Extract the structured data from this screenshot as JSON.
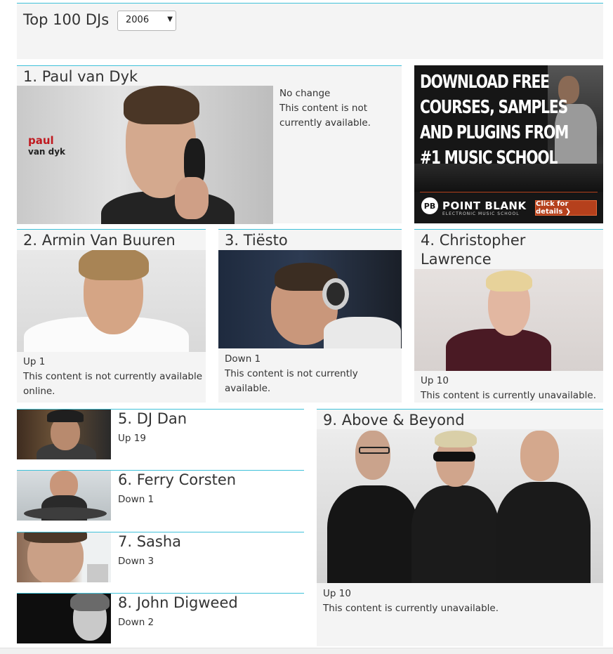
{
  "header": {
    "title": "Top 100 DJs",
    "year_select": "2006"
  },
  "djs": [
    {
      "title": "1. Paul van Dyk",
      "change": "No change",
      "note": "This content is not currently available.",
      "logo_line1": "paul",
      "logo_line2": "van dyk"
    },
    {
      "title": "2. Armin Van Buuren",
      "change": "Up 1",
      "note": "This content is not currently available online."
    },
    {
      "title": "3. Tiësto",
      "change": "Down 1",
      "note": "This content is not currently available."
    },
    {
      "title": "4. Christopher Lawrence",
      "change": "Up 10",
      "note": "This content is currently unavailable."
    },
    {
      "title": "5. DJ Dan",
      "change": "Up 19"
    },
    {
      "title": "6. Ferry Corsten",
      "change": "Down 1"
    },
    {
      "title": "7. Sasha",
      "change": "Down 3"
    },
    {
      "title": "8. John Digweed",
      "change": "Down 2"
    },
    {
      "title": "9. Above & Beyond",
      "change": "Up 10",
      "note": "This content is currently unavailable."
    }
  ],
  "ad": {
    "headline": [
      "DOWNLOAD FREE",
      "COURSES, SAMPLES",
      "AND PLUGINS FROM",
      "#1 MUSIC SCHOOL"
    ],
    "logo": "PB",
    "brand": "POINT BLANK",
    "brand_sub": "ELECTRONIC MUSIC SCHOOL",
    "cta": "Click for details ❯"
  },
  "colors": {
    "accent": "#3ec1d9",
    "card_bg": "#f4f4f4",
    "text": "#333333",
    "ad_bg": "#161616",
    "ad_cta": "#b5401c"
  }
}
